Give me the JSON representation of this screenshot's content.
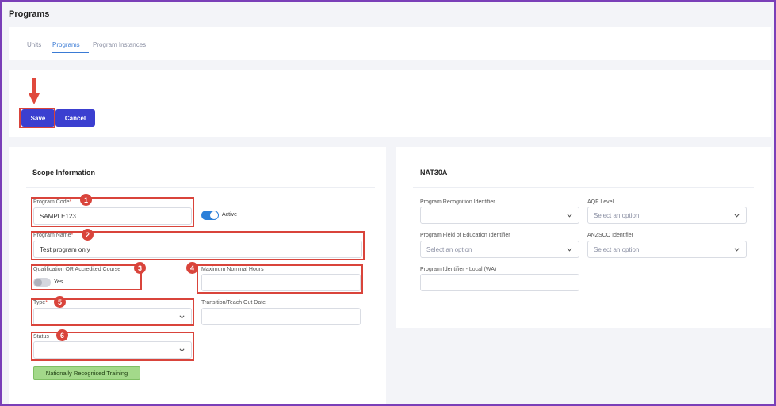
{
  "page": {
    "title": "Programs"
  },
  "tabs": [
    {
      "label": "Units",
      "active": false
    },
    {
      "label": "Programs",
      "active": true
    },
    {
      "label": "Program Instances",
      "active": false
    }
  ],
  "actions": {
    "save_label": "Save",
    "cancel_label": "Cancel"
  },
  "scope": {
    "title": "Scope Information",
    "program_code": {
      "label": "Program Code",
      "required_mark": "*",
      "value": "SAMPLE123",
      "badge": "1"
    },
    "active_toggle": {
      "label": "Active",
      "on": true
    },
    "program_name": {
      "label": "Program Name",
      "required_mark": "*",
      "value": "Test program only",
      "badge": "2"
    },
    "qualification": {
      "label": "Qualification OR Accredited Course",
      "toggle_label": "Yes",
      "on": false,
      "badge": "3"
    },
    "max_hours": {
      "label": "Maximum Nominal Hours",
      "value": "",
      "badge": "4"
    },
    "type": {
      "label": "Type",
      "required_mark": "*",
      "value": "",
      "badge": "5"
    },
    "transition_date": {
      "label": "Transition/Teach Out Date",
      "value": ""
    },
    "status": {
      "label": "Status",
      "value": "",
      "badge": "6"
    },
    "nrt_label": "Nationally Recognised Training"
  },
  "nat30a": {
    "title": "NAT30A",
    "recognition_id": {
      "label": "Program Recognition Identifier",
      "value": ""
    },
    "aqf_level": {
      "label": "AQF Level",
      "placeholder": "Select an option"
    },
    "field_of_education": {
      "label": "Program Field of Education Identifier",
      "placeholder": "Select an option"
    },
    "anzsco": {
      "label": "ANZSCO Identifier",
      "placeholder": "Select an option"
    },
    "local_wa": {
      "label": "Program Identifier - Local (WA)",
      "value": ""
    }
  },
  "colors": {
    "accent": "#3b3fd0",
    "tab_active": "#3a7bd5",
    "annotation_red": "#d9443b",
    "nrt_green": "#a3d98a",
    "toggle_on": "#2b7fd9"
  },
  "icons": [
    "down-arrow-annotation-icon",
    "chevron-down-icon"
  ]
}
